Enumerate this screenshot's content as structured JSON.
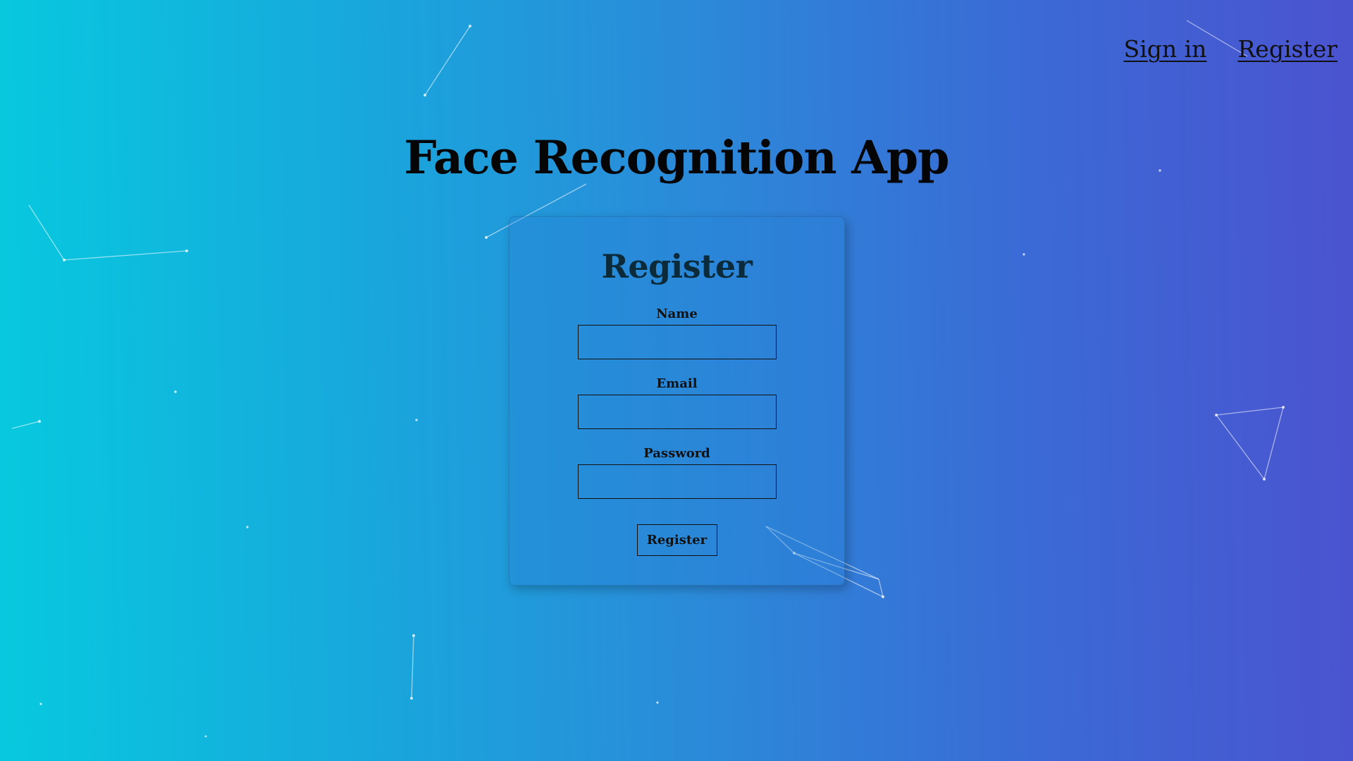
{
  "nav": {
    "sign_in_label": "Sign in",
    "register_label": "Register"
  },
  "app_title": "Face Recognition App",
  "form": {
    "title": "Register",
    "fields": [
      {
        "label": "Name",
        "value": "",
        "placeholder": ""
      },
      {
        "label": "Email",
        "value": "",
        "placeholder": ""
      },
      {
        "label": "Password",
        "value": "",
        "placeholder": ""
      }
    ],
    "submit_label": "Register"
  },
  "colors": {
    "gradient_start": "#07c9de",
    "gradient_end": "#4b53cf",
    "text": "#0b0b0b"
  }
}
